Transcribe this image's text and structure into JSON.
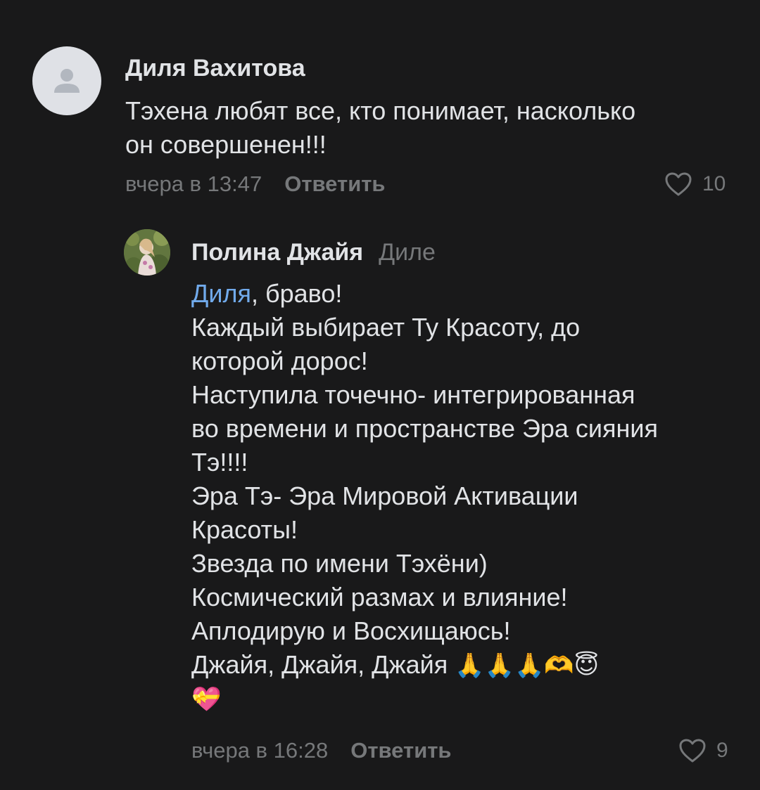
{
  "comments": [
    {
      "author": "Диля Вахитова",
      "lines": [
        "Тэхена любят все, кто понимает, насколько",
        "он совершенен!!!"
      ],
      "time": "вчера в 13:47",
      "reply_label": "Ответить",
      "likes": "10"
    },
    {
      "author": "Полина Джайя",
      "reply_to": "Диле",
      "mention": "Диля",
      "first_line_rest": ", браво!",
      "lines": [
        "Каждый выбирает Ту Красоту, до",
        "которой дорос!",
        "Наступила точечно- интегрированная",
        "во времени и пространстве Эра сияния",
        "Тэ!!!!",
        "Эра Тэ- Эра Мировой Активации",
        "Красоты!",
        "Звезда по имени Тэхёни)",
        "Космический размах и влияние!",
        "Аплодирую и Восхищаюсь!"
      ],
      "last_line_text": "Джайя, Джайя, Джайя ",
      "emoji_line": "🙏🙏🙏🫶😇",
      "emoji_line2": "💝",
      "time": "вчера в 16:28",
      "reply_label": "Ответить",
      "likes": "9"
    }
  ],
  "icons": {
    "avatar_placeholder": "user-icon",
    "like": "heart-outline-icon"
  },
  "colors": {
    "background": "#19191a",
    "text": "#e1e3e6",
    "secondary": "#76787a",
    "mention": "#71aaeb"
  }
}
